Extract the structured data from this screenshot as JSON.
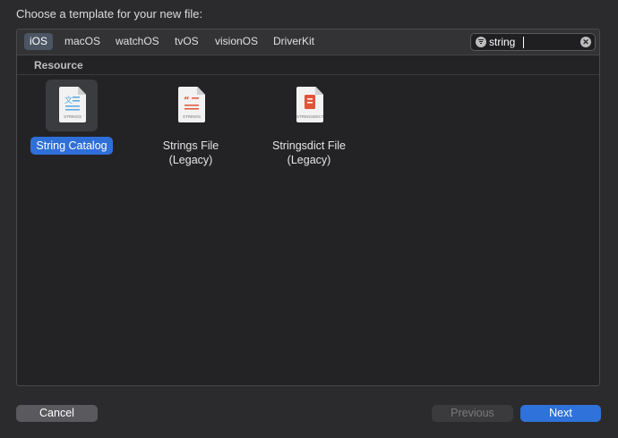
{
  "dialog": {
    "title": "Choose a template for your new file:"
  },
  "platform_tabs": [
    {
      "label": "iOS",
      "selected": true
    },
    {
      "label": "macOS",
      "selected": false
    },
    {
      "label": "watchOS",
      "selected": false
    },
    {
      "label": "tvOS",
      "selected": false
    },
    {
      "label": "visionOS",
      "selected": false
    },
    {
      "label": "DriverKit",
      "selected": false
    }
  ],
  "search": {
    "value": "string",
    "left_icon": "filter-icon",
    "right_icon": "clear-icon"
  },
  "section": {
    "title": "Resource"
  },
  "templates": [
    {
      "label": "String Catalog",
      "icon": "string-catalog-icon",
      "icon_tag": "STRINGS",
      "selected": true
    },
    {
      "label": "Strings File (Legacy)",
      "label_line1": "Strings File",
      "label_line2": "(Legacy)",
      "icon": "strings-file-icon",
      "icon_tag": "STRINGS",
      "selected": false
    },
    {
      "label": "Stringsdict File (Legacy)",
      "label_line1": "Stringsdict File",
      "label_line2": "(Legacy)",
      "icon": "stringsdict-file-icon",
      "icon_tag": "STRINGSDICT",
      "selected": false
    }
  ],
  "buttons": {
    "cancel": "Cancel",
    "previous": "Previous",
    "next": "Next"
  },
  "colors": {
    "accent": "#2f72d9",
    "selection": "#2f6fd8",
    "background": "#2b2b2d",
    "icon_red": "#e2543a",
    "icon_blue": "#5aa6e0"
  }
}
